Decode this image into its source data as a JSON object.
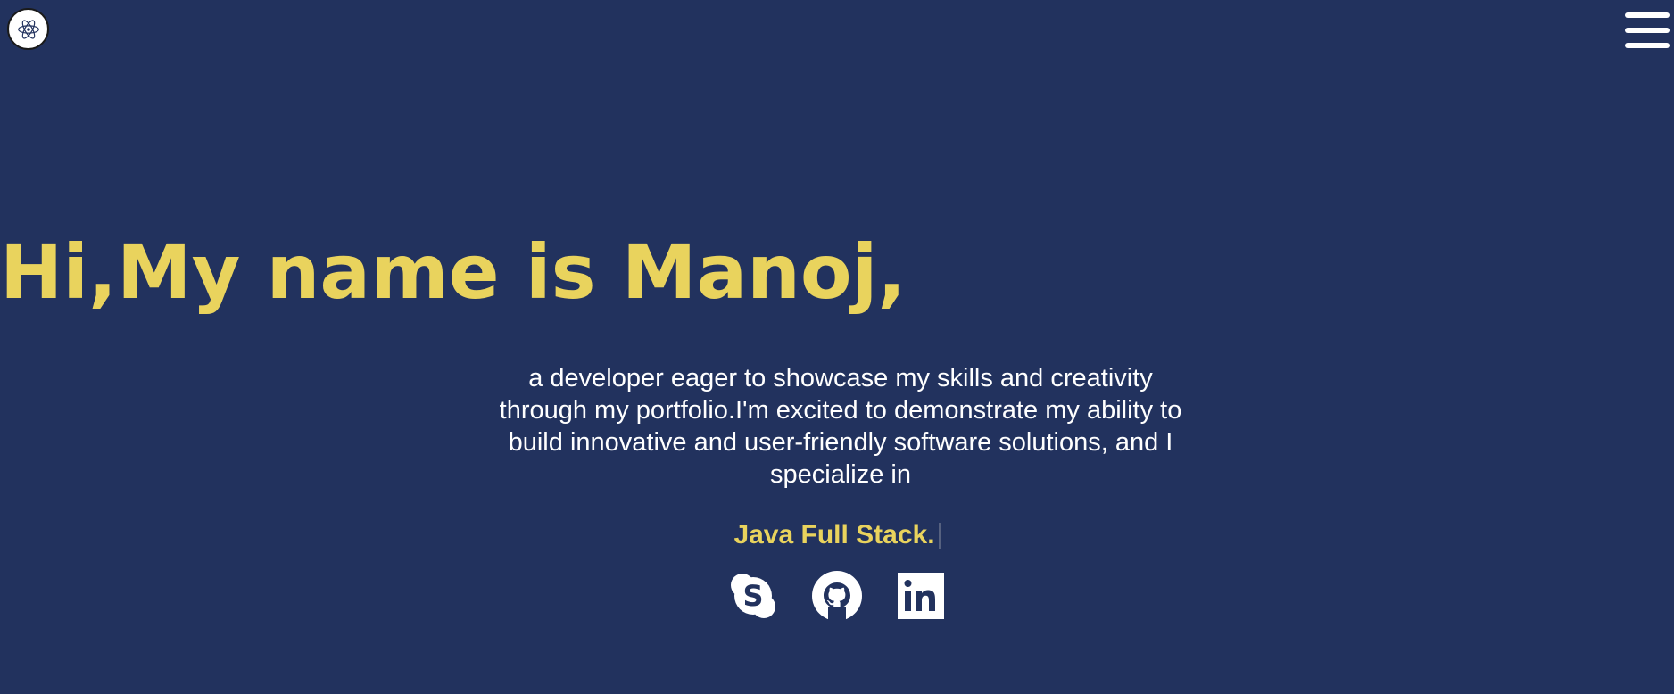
{
  "header": {
    "logo_icon": "atom-icon",
    "menu_icon": "hamburger-menu-icon"
  },
  "hero": {
    "title": "Hi,My name is Manoj,",
    "intro": "a developer eager to showcase my skills and creativity through my portfolio.I'm excited to demonstrate my ability to build innovative and user-friendly software solutions, and I specialize in",
    "specialty": "Java Full Stack."
  },
  "socials": [
    {
      "icon": "skype-icon"
    },
    {
      "icon": "github-icon"
    },
    {
      "icon": "linkedin-icon"
    }
  ],
  "colors": {
    "background": "#22325e",
    "accent": "#e9d35d",
    "text": "#ffffff"
  }
}
